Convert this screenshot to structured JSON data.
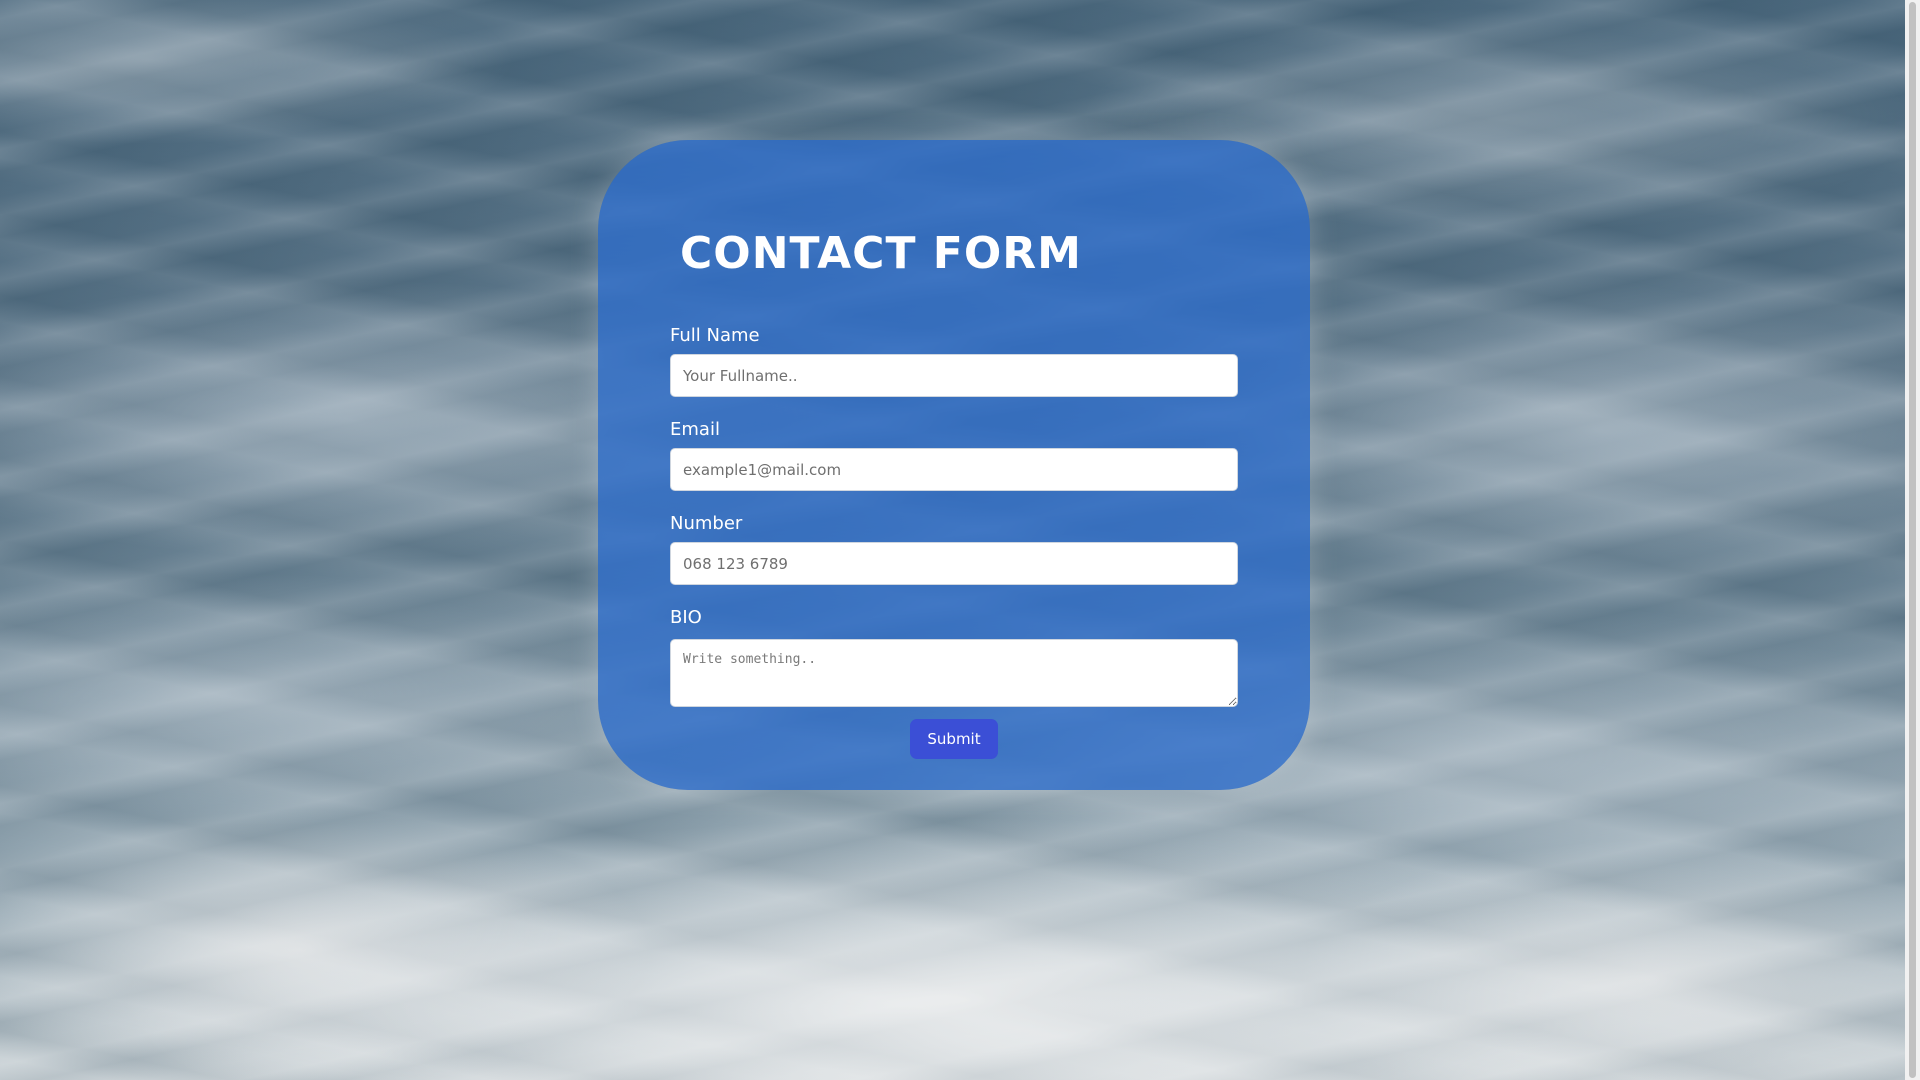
{
  "form": {
    "title": "CONTACT FORM",
    "fields": [
      {
        "label": "Full Name",
        "placeholder": "Your Fullname..",
        "value": ""
      },
      {
        "label": "Email",
        "placeholder": "example1@mail.com",
        "value": ""
      },
      {
        "label": "Number",
        "placeholder": "068 123 6789",
        "value": ""
      },
      {
        "label": "BIO",
        "placeholder": "Write something..",
        "value": ""
      }
    ],
    "submit_label": "Submit"
  },
  "colors": {
    "card": "#2e6ecd",
    "submit": "#3b4fd6",
    "text": "#ffffff"
  }
}
